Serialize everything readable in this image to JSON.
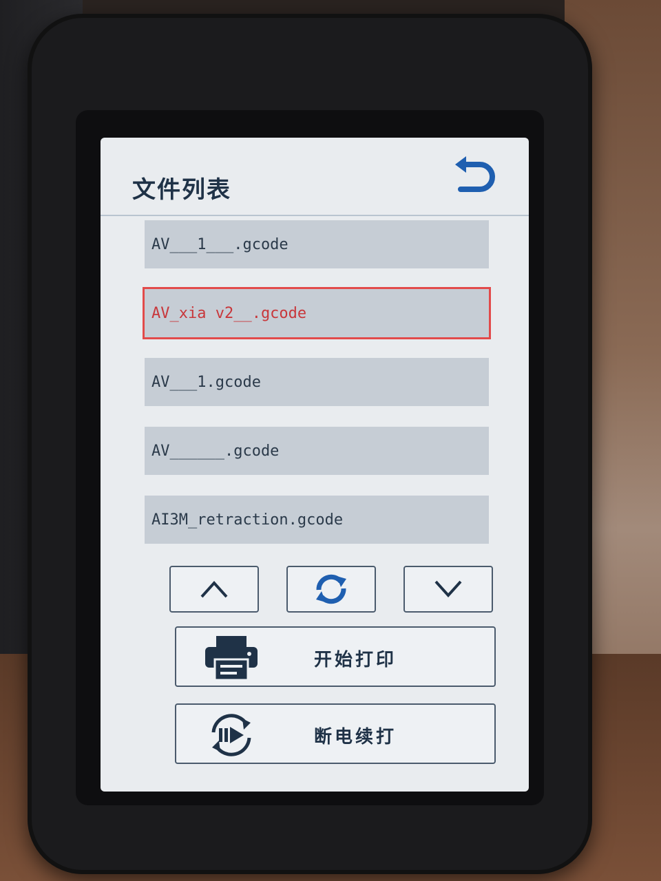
{
  "screen": {
    "title": "文件列表",
    "back_icon": "return-icon",
    "files": [
      {
        "name": "AV___1___.gcode",
        "selected": false
      },
      {
        "name": "AV_xia v2__.gcode",
        "selected": true
      },
      {
        "name": "AV___1.gcode",
        "selected": false
      },
      {
        "name": "AV______.gcode",
        "selected": false
      },
      {
        "name": "AI3M_retraction.gcode",
        "selected": false
      }
    ],
    "nav": {
      "up_icon": "chevron-up-icon",
      "refresh_icon": "refresh-icon",
      "down_icon": "chevron-down-icon"
    },
    "actions": {
      "print_label": "开始打印",
      "print_icon": "printer-icon",
      "resume_label": "断电续打",
      "resume_icon": "resume-icon"
    }
  },
  "colors": {
    "screen_bg": "#e9ecef",
    "item_bg": "#c6cdd5",
    "selected_text": "#c8373b",
    "selection_outline": "#e24a4a",
    "accent": "#1f5fb0",
    "text": "#1f3247"
  }
}
